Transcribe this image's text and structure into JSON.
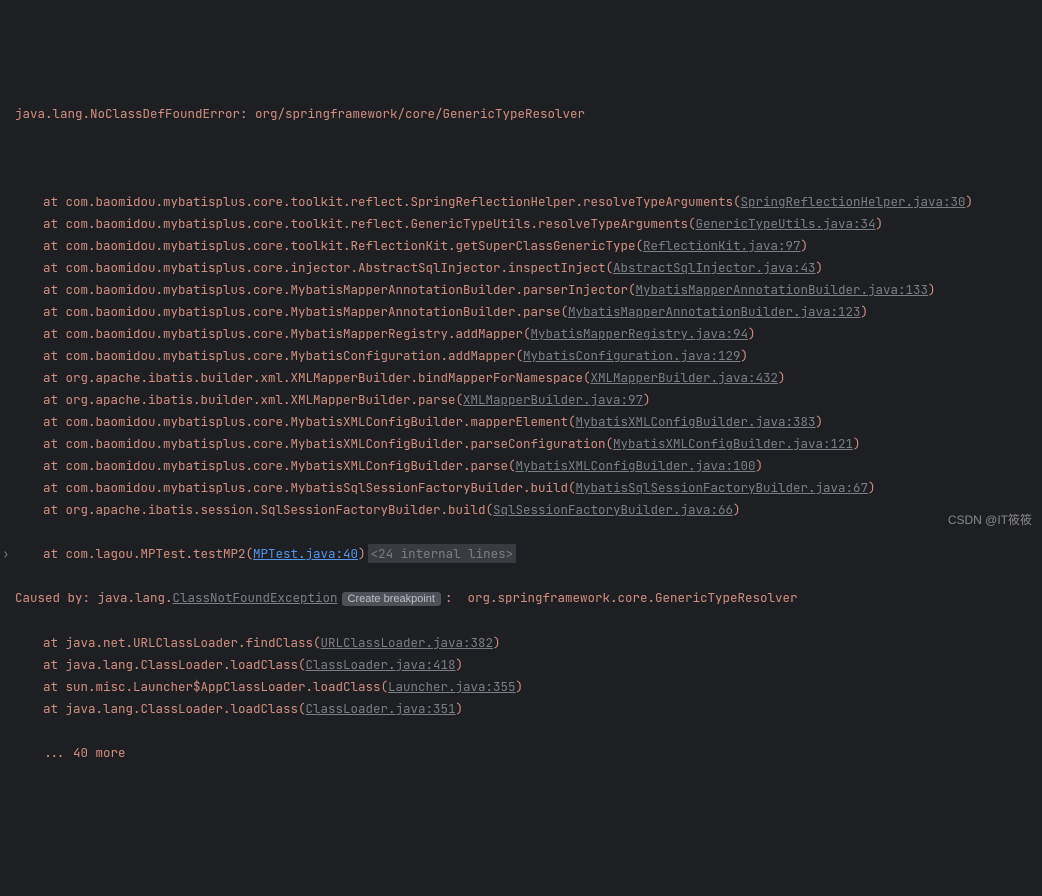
{
  "error": "java.lang.NoClassDefFoundError: org/springframework/core/GenericTypeResolver",
  "at_prefix": "at ",
  "frames": [
    {
      "m": "com.baomidou.mybatisplus.core.toolkit.reflect.SpringReflectionHelper.resolveTypeArguments",
      "f": "SpringReflectionHelper.java:30"
    },
    {
      "m": "com.baomidou.mybatisplus.core.toolkit.reflect.GenericTypeUtils.resolveTypeArguments",
      "f": "GenericTypeUtils.java:34"
    },
    {
      "m": "com.baomidou.mybatisplus.core.toolkit.ReflectionKit.getSuperClassGenericType",
      "f": "ReflectionKit.java:97"
    },
    {
      "m": "com.baomidou.mybatisplus.core.injector.AbstractSqlInjector.inspectInject",
      "f": "AbstractSqlInjector.java:43"
    },
    {
      "m": "com.baomidou.mybatisplus.core.MybatisMapperAnnotationBuilder.parserInjector",
      "f": "MybatisMapperAnnotationBuilder.java:133"
    },
    {
      "m": "com.baomidou.mybatisplus.core.MybatisMapperAnnotationBuilder.parse",
      "f": "MybatisMapperAnnotationBuilder.java:123"
    },
    {
      "m": "com.baomidou.mybatisplus.core.MybatisMapperRegistry.addMapper",
      "f": "MybatisMapperRegistry.java:94"
    },
    {
      "m": "com.baomidou.mybatisplus.core.MybatisConfiguration.addMapper",
      "f": "MybatisConfiguration.java:129"
    },
    {
      "m": "org.apache.ibatis.builder.xml.XMLMapperBuilder.bindMapperForNamespace",
      "f": "XMLMapperBuilder.java:432"
    },
    {
      "m": "org.apache.ibatis.builder.xml.XMLMapperBuilder.parse",
      "f": "XMLMapperBuilder.java:97"
    },
    {
      "m": "com.baomidou.mybatisplus.core.MybatisXMLConfigBuilder.mapperElement",
      "f": "MybatisXMLConfigBuilder.java:383"
    },
    {
      "m": "com.baomidou.mybatisplus.core.MybatisXMLConfigBuilder.parseConfiguration",
      "f": "MybatisXMLConfigBuilder.java:121"
    },
    {
      "m": "com.baomidou.mybatisplus.core.MybatisXMLConfigBuilder.parse",
      "f": "MybatisXMLConfigBuilder.java:100"
    },
    {
      "m": "com.baomidou.mybatisplus.core.MybatisSqlSessionFactoryBuilder.build",
      "f": "MybatisSqlSessionFactoryBuilder.java:67"
    },
    {
      "m": "org.apache.ibatis.session.SqlSessionFactoryBuilder.build",
      "f": "SqlSessionFactoryBuilder.java:66"
    }
  ],
  "user_frame": {
    "m": "com.lagou.MPTest.testMP2",
    "f": "MPTest.java:40"
  },
  "internal_collapsed": "<24 internal lines>",
  "caused_by_prefix": "Caused by: java.lang.",
  "caused_exception": "ClassNotFoundException",
  "bp_label": "Create breakpoint",
  "caused_suffix": ":  org.springframework.core.GenericTypeResolver",
  "cause_frames": [
    {
      "m": "java.net.URLClassLoader.findClass",
      "f": "URLClassLoader.java:382"
    },
    {
      "m": "java.lang.ClassLoader.loadClass",
      "f": "ClassLoader.java:418"
    },
    {
      "m": "sun.misc.Launcher$AppClassLoader.loadClass",
      "f": "Launcher.java:355"
    },
    {
      "m": "java.lang.ClassLoader.loadClass",
      "f": "ClassLoader.java:351"
    }
  ],
  "more": "... 40 more",
  "chev": "›",
  "watermark": "CSDN @IT筱筱"
}
